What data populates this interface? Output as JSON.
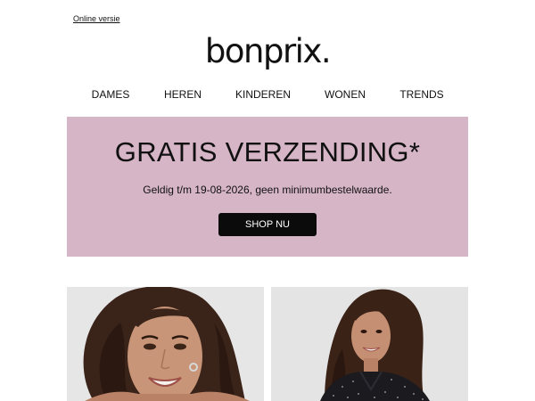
{
  "header": {
    "online_link": "Online versie",
    "logo_text": "bonprix."
  },
  "nav": {
    "items": [
      {
        "label": "DAMES"
      },
      {
        "label": "HEREN"
      },
      {
        "label": "KINDEREN"
      },
      {
        "label": "WONEN"
      },
      {
        "label": "TRENDS"
      }
    ]
  },
  "promo": {
    "title": "GRATIS VERZENDING*",
    "subtitle": "Geldig t/m 19-08-2026, geen minimumbestelwaarde.",
    "button_label": "SHOP NU",
    "background_color": "#d6b5c6",
    "button_color": "#0b0b0b"
  },
  "tiles": [
    {
      "icon": "model-photo-left"
    },
    {
      "icon": "model-photo-right"
    }
  ]
}
